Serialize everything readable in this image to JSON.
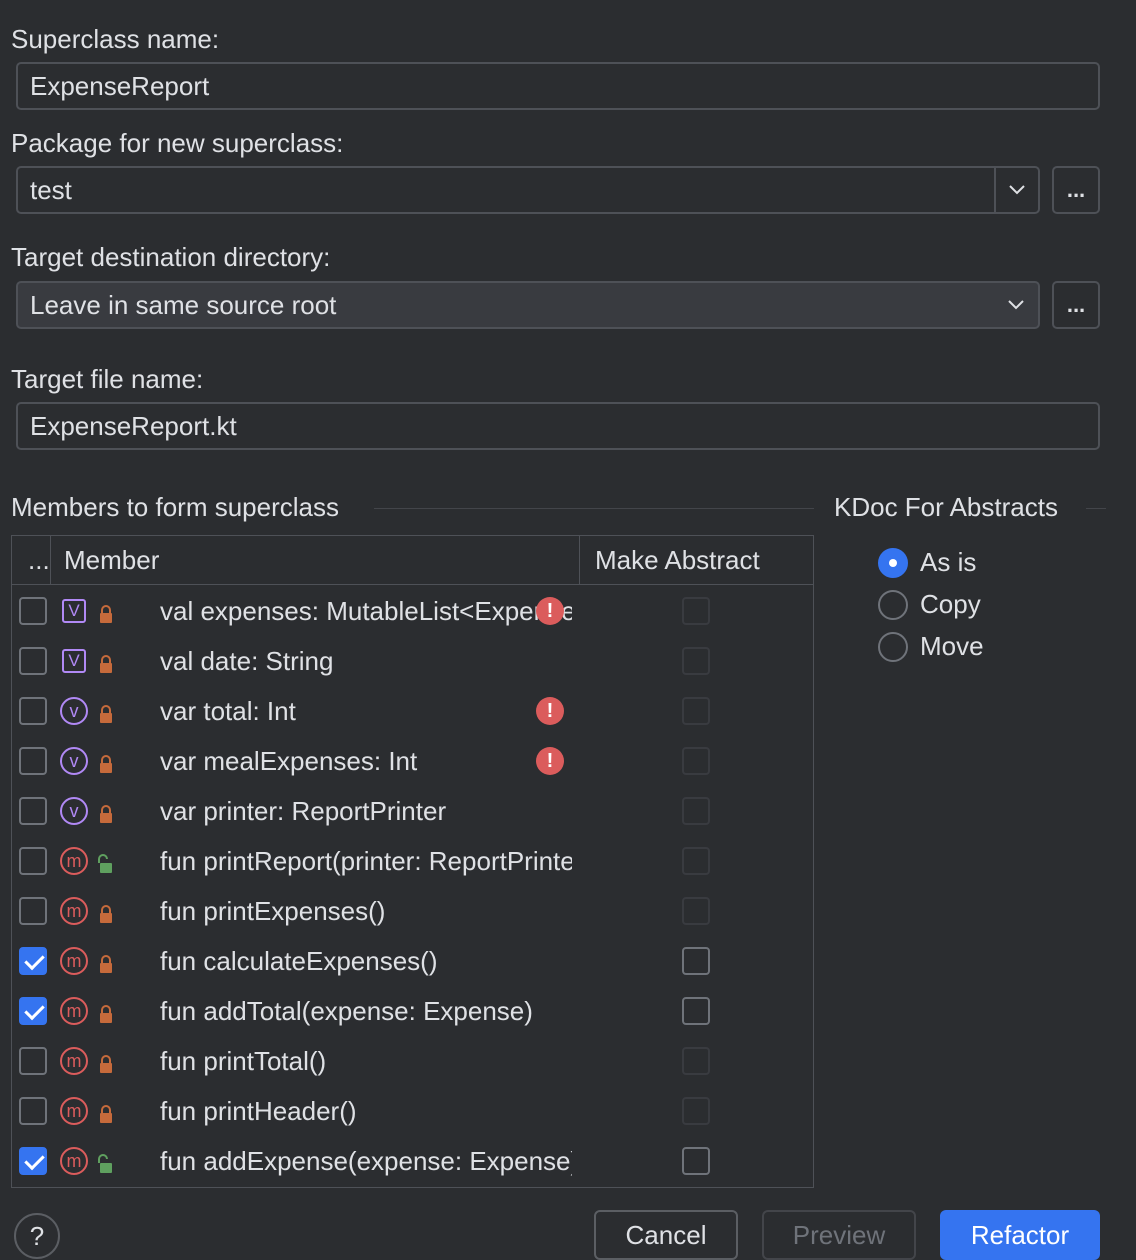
{
  "superclass": {
    "label": "Superclass name:",
    "value": "ExpenseReport"
  },
  "package": {
    "label": "Package for new superclass:",
    "value": "test",
    "browse": "..."
  },
  "target_dir": {
    "label": "Target destination directory:",
    "value": "Leave in same source root",
    "browse": "..."
  },
  "target_file": {
    "label": "Target file name:",
    "value": "ExpenseReport.kt"
  },
  "members": {
    "title": "Members to form superclass",
    "headers": {
      "check": "...",
      "member": "Member",
      "abstract": "Make Abstract"
    },
    "rows": [
      {
        "text": "val expenses: MutableList<Expense>",
        "checked": false,
        "icon": "v-square",
        "lock": "locked",
        "error": true,
        "abstract_enabled": false
      },
      {
        "text": "val date: String",
        "checked": false,
        "icon": "v-square",
        "lock": "locked",
        "error": false,
        "abstract_enabled": false
      },
      {
        "text": "var total: Int",
        "checked": false,
        "icon": "v-circle",
        "lock": "locked",
        "error": true,
        "abstract_enabled": false
      },
      {
        "text": "var mealExpenses: Int",
        "checked": false,
        "icon": "v-circle",
        "lock": "locked",
        "error": true,
        "abstract_enabled": false
      },
      {
        "text": "var printer: ReportPrinter",
        "checked": false,
        "icon": "v-circle",
        "lock": "locked",
        "error": false,
        "abstract_enabled": false
      },
      {
        "text": "fun printReport(printer: ReportPrinter)",
        "checked": false,
        "icon": "m",
        "lock": "unlocked",
        "error": false,
        "abstract_enabled": false
      },
      {
        "text": "fun printExpenses()",
        "checked": false,
        "icon": "m",
        "lock": "locked",
        "error": false,
        "abstract_enabled": false
      },
      {
        "text": "fun calculateExpenses()",
        "checked": true,
        "icon": "m",
        "lock": "locked",
        "error": false,
        "abstract_enabled": true
      },
      {
        "text": "fun addTotal(expense: Expense)",
        "checked": true,
        "icon": "m",
        "lock": "locked",
        "error": false,
        "abstract_enabled": true
      },
      {
        "text": "fun printTotal()",
        "checked": false,
        "icon": "m",
        "lock": "locked",
        "error": false,
        "abstract_enabled": false
      },
      {
        "text": "fun printHeader()",
        "checked": false,
        "icon": "m",
        "lock": "locked",
        "error": false,
        "abstract_enabled": false
      },
      {
        "text": "fun addExpense(expense: Expense)",
        "checked": true,
        "icon": "m",
        "lock": "unlocked",
        "error": false,
        "abstract_enabled": true
      }
    ]
  },
  "kdoc": {
    "title": "KDoc For Abstracts",
    "options": [
      "As is",
      "Copy",
      "Move"
    ],
    "selected": 0
  },
  "buttons": {
    "help": "?",
    "cancel": "Cancel",
    "preview": "Preview",
    "refactor": "Refactor"
  },
  "colors": {
    "accent": "#3574f0",
    "error": "#db5c5c",
    "property": "#b189f5",
    "lock_private": "#c66a3b",
    "lock_public": "#5fa05f"
  }
}
